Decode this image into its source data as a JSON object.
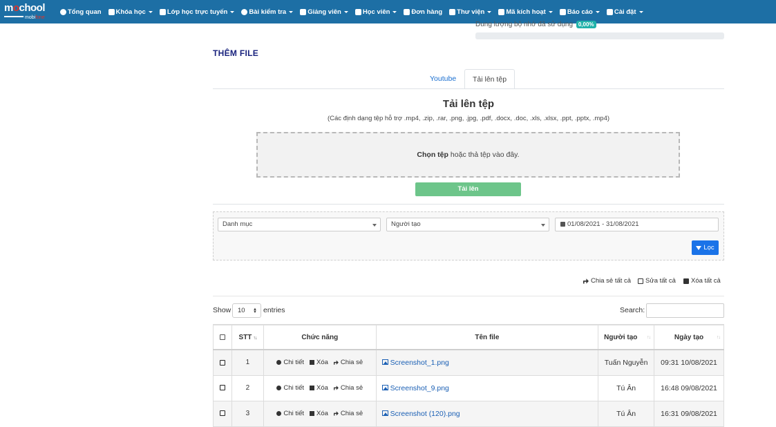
{
  "brand": {
    "logo_main": "m",
    "logo_mid": "o",
    "logo_tail": "chool",
    "logo_sub": "mobi",
    "logo_sub_red": "fone"
  },
  "nav": {
    "items": [
      {
        "label": "Tổng quan",
        "icon": "dashboard-icon",
        "caret": false
      },
      {
        "label": "Khóa học",
        "icon": "course-icon",
        "caret": true
      },
      {
        "label": "Lớp học trực tuyến",
        "icon": "video-icon",
        "caret": true
      },
      {
        "label": "Bài kiểm tra",
        "icon": "question-icon",
        "caret": true
      },
      {
        "label": "Giảng viên",
        "icon": "teachers-icon",
        "caret": true
      },
      {
        "label": "Học viên",
        "icon": "user-icon",
        "caret": true
      },
      {
        "label": "Đơn hàng",
        "icon": "cart-icon",
        "caret": false
      },
      {
        "label": "Thư viện",
        "icon": "book-icon",
        "caret": true
      },
      {
        "label": "Mã kích hoạt",
        "icon": "ticket-icon",
        "caret": true
      },
      {
        "label": "Báo cáo",
        "icon": "chart-icon",
        "caret": true
      },
      {
        "label": "Cài đặt",
        "icon": "gears-icon",
        "caret": true
      }
    ]
  },
  "storage": {
    "text": "Dung lượng bộ nhớ đã sử dụng",
    "percent_label": "0,00%",
    "used_fraction": 0.0
  },
  "page": {
    "heading": "THÊM FILE"
  },
  "tabs": {
    "youtube": "Youtube",
    "upload": "Tải lên tệp",
    "active": "upload"
  },
  "upload": {
    "title": "Tải lên tệp",
    "formats": "(Các định dạng tệp hỗ trợ .mp4, .zip, .rar, .png, .jpg, .pdf, .docx, .doc, .xls, .xlsx, .ppt, .pptx, .mp4)",
    "drop_bold": "Chọn tệp",
    "drop_rest": "hoặc thả tệp vào đây.",
    "button": "Tải lên"
  },
  "filters": {
    "category_placeholder": "Danh mục",
    "creator_placeholder": "Người tạo",
    "date_range": "01/08/2021 - 31/08/2021",
    "filter_button": "Lọc"
  },
  "bulk_actions": {
    "share_all": "Chia sẻ tất cả",
    "edit_all": "Sửa tất cả",
    "delete_all": "Xóa tất cả"
  },
  "table_controls": {
    "show": "Show",
    "page_size": "10",
    "entries": "entries",
    "search": "Search:"
  },
  "table": {
    "headers": {
      "stt": "STT",
      "functions": "Chức năng",
      "filename": "Tên file",
      "creator": "Người tạo",
      "created": "Ngày tạo"
    },
    "actions": {
      "detail": "Chi tiết",
      "delete": "Xóa",
      "share": "Chia sẻ"
    },
    "rows": [
      {
        "stt": "1",
        "filename": "Screenshot_1.png",
        "creator": "Tuấn Nguyễn",
        "created": "09:31 10/08/2021"
      },
      {
        "stt": "2",
        "filename": "Screenshot_9.png",
        "creator": "Tú Ân",
        "created": "16:48 09/08/2021"
      },
      {
        "stt": "3",
        "filename": "Screenshot (120).png",
        "creator": "Tú Ân",
        "created": "16:31 09/08/2021"
      }
    ]
  }
}
